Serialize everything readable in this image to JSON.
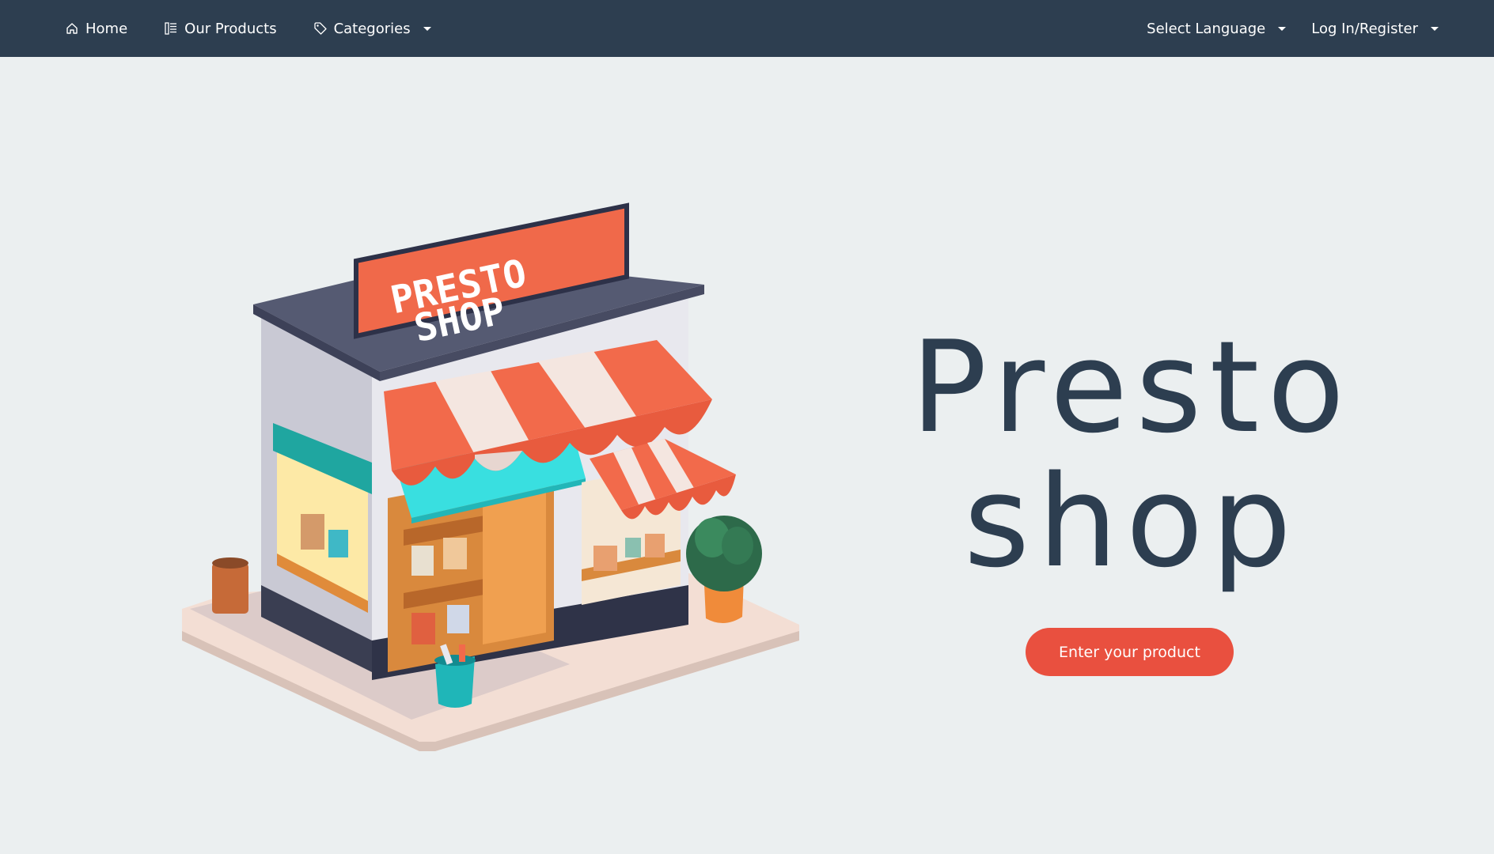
{
  "nav": {
    "home": {
      "label": "Home",
      "icon": "home-icon"
    },
    "products": {
      "label": "Our Products",
      "icon": "list-icon"
    },
    "categories": {
      "label": "Categories",
      "icon": "tag-icon"
    },
    "language": {
      "label": "Select Language"
    },
    "account": {
      "label": "Log In/Register"
    }
  },
  "hero": {
    "title_line1": "Presto",
    "title_line2": "shop",
    "cta_label": "Enter your product",
    "sign_line1": "PRESTO",
    "sign_line2": "SHOP"
  },
  "colors": {
    "navbar": "#2d3e50",
    "background": "#ebeff0",
    "accent": "#e9503f",
    "awning": "#f26a4b",
    "teal": "#2fc7c0"
  }
}
